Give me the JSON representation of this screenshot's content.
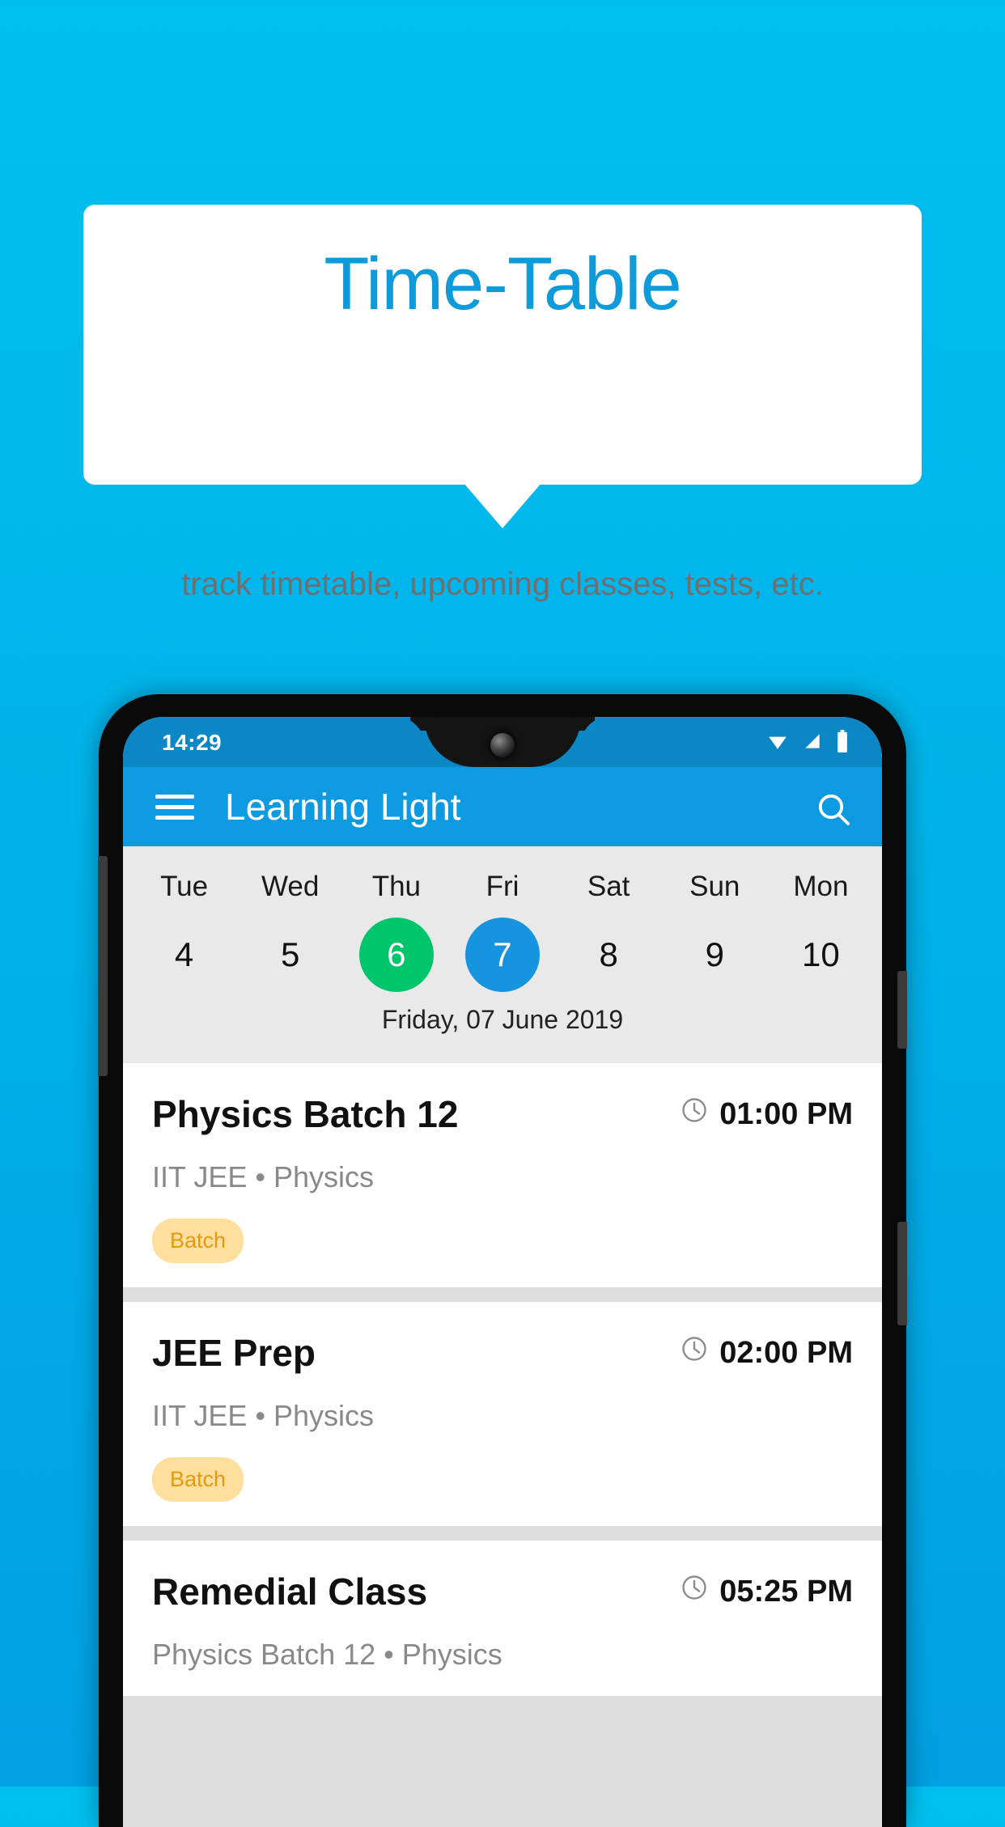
{
  "promo": {
    "title": "Time-Table",
    "subtitle": "track timetable, upcoming classes, tests, etc.",
    "title_color": "#0f9ada",
    "background_top": "#00c0f0",
    "background_bottom": "#029fe1"
  },
  "phone": {
    "status_bar": {
      "time": "14:29",
      "icons": [
        "wifi-icon",
        "signal-icon",
        "battery-icon"
      ],
      "background": "#0b87c6"
    },
    "app_bar": {
      "menu_icon": "hamburger-menu-icon",
      "title": "Learning Light",
      "search_icon": "search-icon",
      "background": "#0d9ae0"
    },
    "day_strip": {
      "days": [
        {
          "name": "Tue",
          "number": "4",
          "state": "normal"
        },
        {
          "name": "Wed",
          "number": "5",
          "state": "normal"
        },
        {
          "name": "Thu",
          "number": "6",
          "state": "today"
        },
        {
          "name": "Fri",
          "number": "7",
          "state": "selected"
        },
        {
          "name": "Sat",
          "number": "8",
          "state": "normal"
        },
        {
          "name": "Sun",
          "number": "9",
          "state": "normal"
        },
        {
          "name": "Mon",
          "number": "10",
          "state": "normal"
        }
      ],
      "today_color": "#00c56b",
      "selected_color": "#1694e0",
      "date_label": "Friday, 07 June 2019",
      "background": "#e9e9e9"
    },
    "schedule": {
      "items": [
        {
          "title": "Physics Batch 12",
          "time": "01:00 PM",
          "time_icon": "clock-icon",
          "subtitle": "IIT JEE • Physics",
          "badge": "Batch"
        },
        {
          "title": "JEE Prep",
          "time": "02:00 PM",
          "time_icon": "clock-icon",
          "subtitle": "IIT JEE • Physics",
          "badge": "Batch"
        },
        {
          "title": "Remedial Class",
          "time": "05:25 PM",
          "time_icon": "clock-icon",
          "subtitle": "Physics Batch 12 • Physics",
          "badge": ""
        }
      ],
      "badge_background": "#ffdf9e",
      "badge_color": "#e09b13"
    }
  }
}
